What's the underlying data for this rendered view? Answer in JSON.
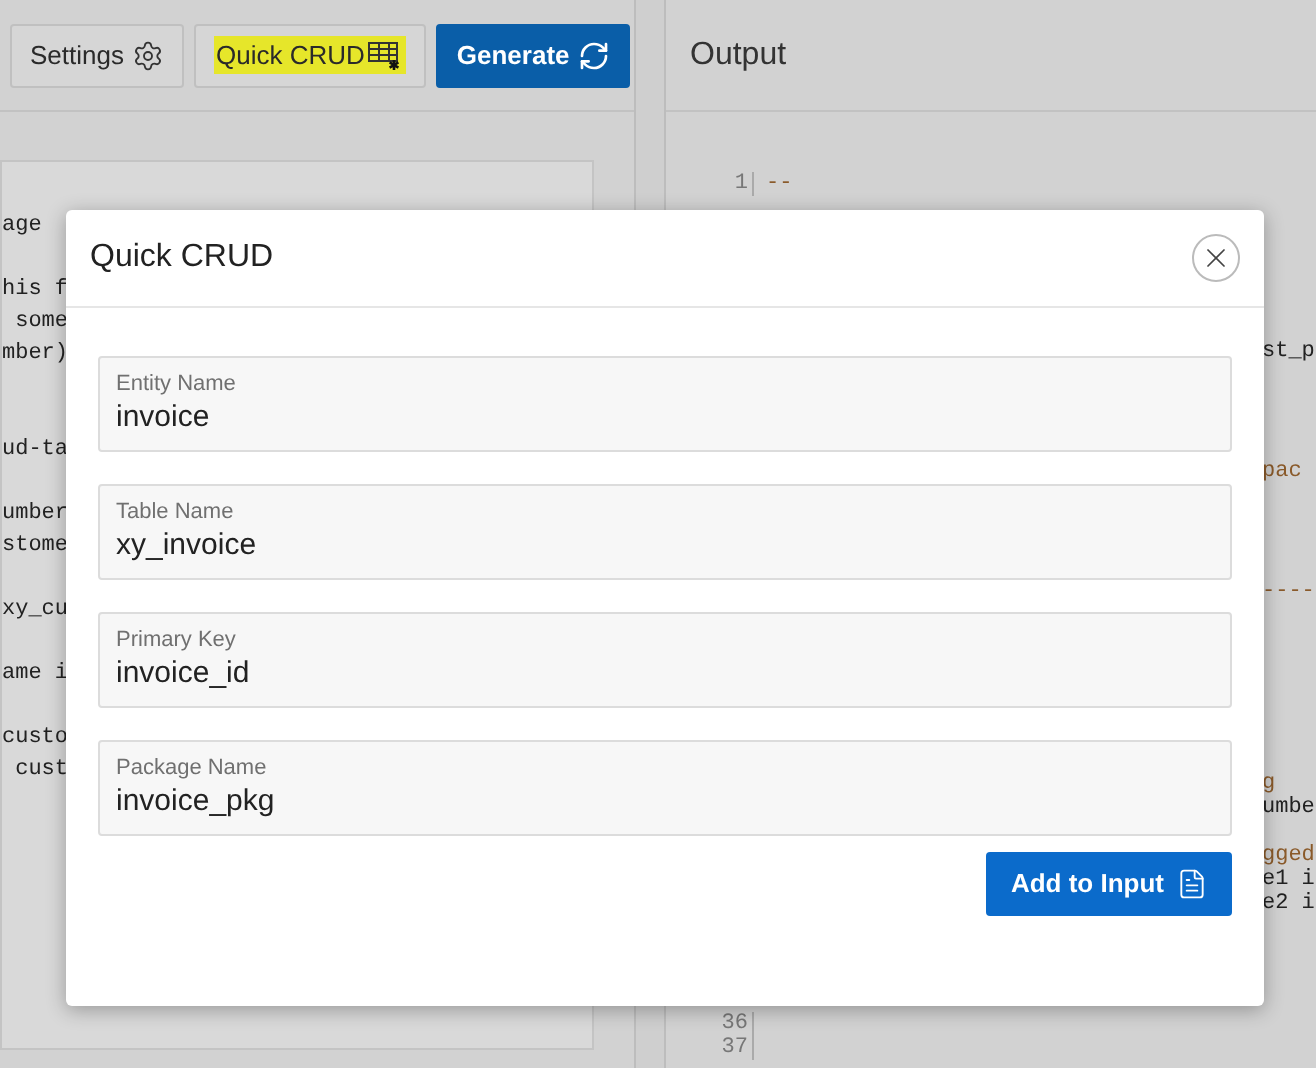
{
  "toolbar": {
    "buttons": [
      {
        "label": "Settings",
        "kind": "settings",
        "primary": false,
        "highlighted": false
      },
      {
        "label": "Quick CRUD",
        "kind": "table",
        "primary": false,
        "highlighted": true
      },
      {
        "label": "Generate",
        "kind": "refresh",
        "primary": true,
        "highlighted": false
      }
    ]
  },
  "input_code": {
    "lines": [
      {
        "text": "age"
      },
      {
        "text": "his f"
      },
      {
        "text": " some"
      },
      {
        "text": "mber)"
      },
      {
        "text": "ud-ta"
      },
      {
        "text": "umber"
      },
      {
        "text": "stome"
      },
      {
        "text": "xy_cu"
      },
      {
        "text": "ame i"
      },
      {
        "text": "custo"
      },
      {
        "text": " cust"
      }
    ]
  },
  "output": {
    "title": "Output",
    "lines": [
      {
        "number": "1",
        "text": "--",
        "kind": "comment"
      },
      {
        "text": "st_p",
        "kind": "code"
      },
      {
        "text": "pac",
        "kind": "comment"
      },
      {
        "text": "----",
        "kind": "comment"
      },
      {
        "text": "g",
        "kind": "comment"
      },
      {
        "text": "umbe",
        "kind": "code"
      },
      {
        "text": "gged",
        "kind": "comment"
      },
      {
        "text": "e1 i",
        "kind": "code"
      },
      {
        "text": "e2 i",
        "kind": "code"
      },
      {
        "number": "36"
      },
      {
        "number": "37"
      }
    ]
  },
  "dialog": {
    "title": "Quick CRUD",
    "fields": [
      {
        "label": "Entity Name",
        "value": "invoice"
      },
      {
        "label": "Table Name",
        "value": "xy_invoice"
      },
      {
        "label": "Primary Key",
        "value": "invoice_id"
      },
      {
        "label": "Package Name",
        "value": "invoice_pkg"
      }
    ],
    "button": "Add to Input"
  }
}
